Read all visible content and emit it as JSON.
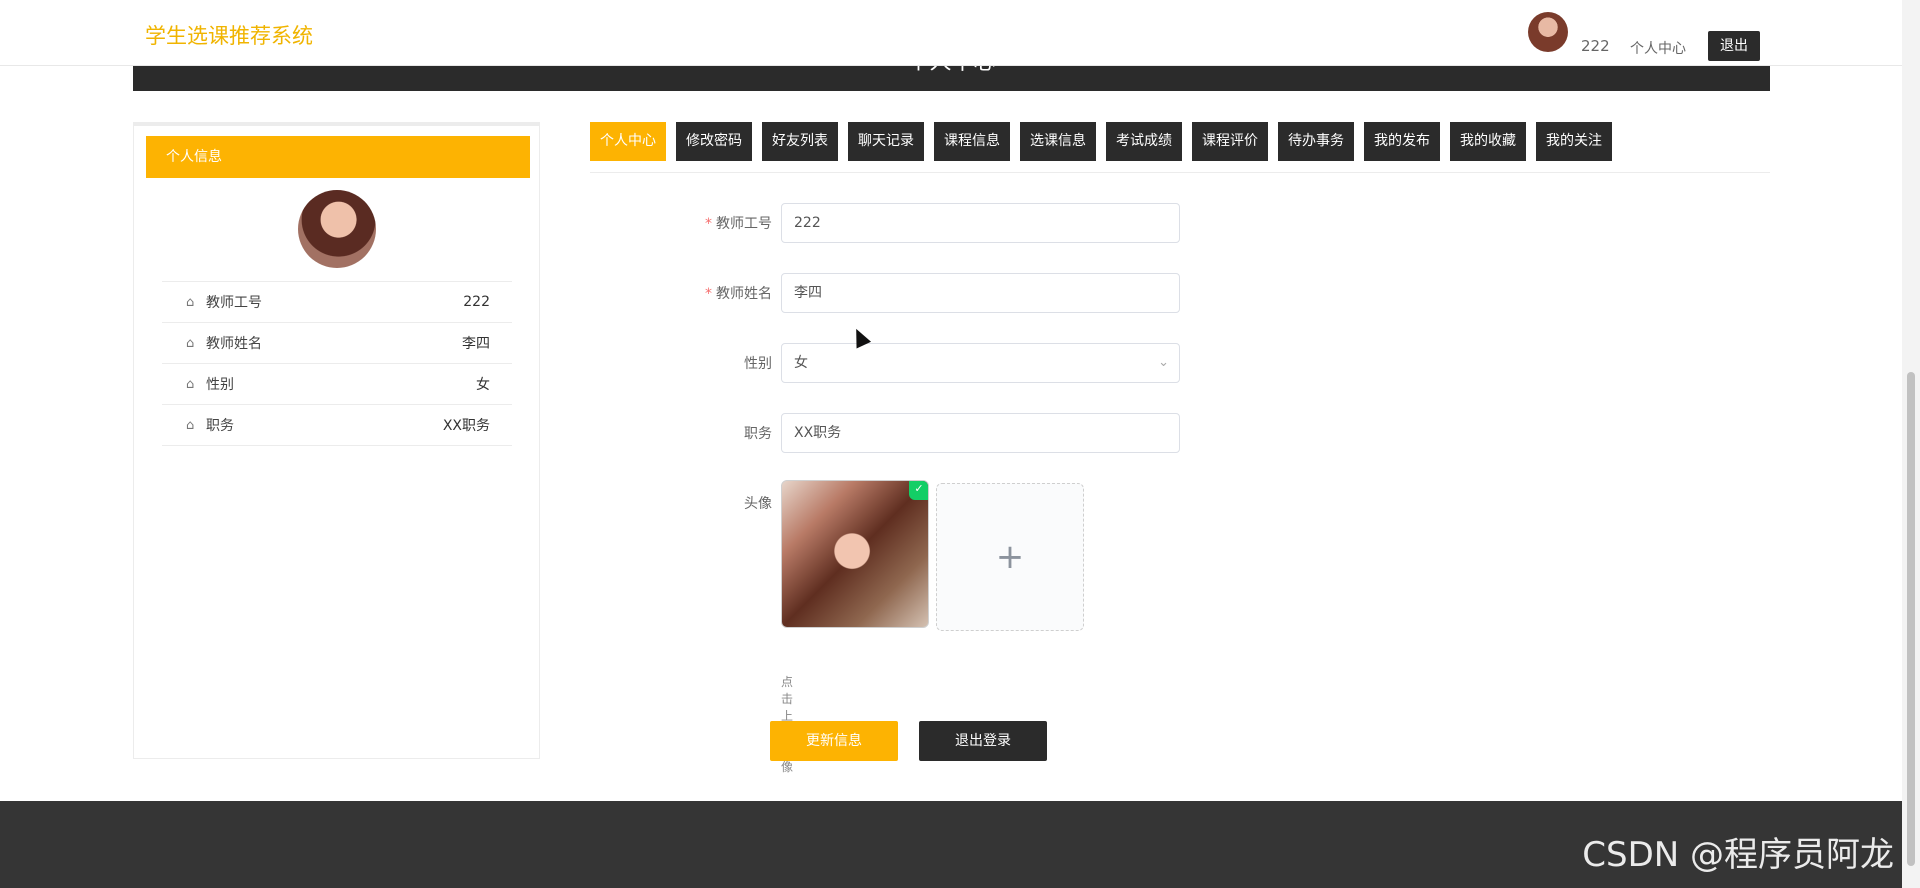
{
  "header": {
    "app_title": "学生选课推荐系统",
    "user_name": "222",
    "profile_center": "个人中心",
    "logout": "退出"
  },
  "banner": {
    "title": "个人中心"
  },
  "left_panel": {
    "title": "个人信息",
    "items": [
      {
        "label": "教师工号",
        "value": "222",
        "icon": "home-icon"
      },
      {
        "label": "教师姓名",
        "value": "李四",
        "icon": "home-icon"
      },
      {
        "label": "性别",
        "value": "女",
        "icon": "home-icon"
      },
      {
        "label": "职务",
        "value": "XX职务",
        "icon": "home-icon"
      }
    ]
  },
  "tabs": [
    {
      "label": "个人中心",
      "active": true
    },
    {
      "label": "修改密码"
    },
    {
      "label": "好友列表"
    },
    {
      "label": "聊天记录"
    },
    {
      "label": "课程信息"
    },
    {
      "label": "选课信息"
    },
    {
      "label": "考试成绩"
    },
    {
      "label": "课程评价"
    },
    {
      "label": "待办事务"
    },
    {
      "label": "我的发布"
    },
    {
      "label": "我的收藏"
    },
    {
      "label": "我的关注"
    }
  ],
  "form": {
    "teacher_id_label": "教师工号",
    "teacher_id_value": "222",
    "teacher_name_label": "教师姓名",
    "teacher_name_value": "李四",
    "gender_label": "性别",
    "gender_value": "女",
    "position_label": "职务",
    "position_value": "XX职务",
    "avatar_label": "头像",
    "upload_tip": "点击上传头像",
    "update_button": "更新信息",
    "logout_button": "退出登录"
  },
  "watermark": "CSDN @程序员阿龙",
  "colors": {
    "accent": "#fdb302",
    "dark": "#2b2b2b",
    "success": "#13ce66"
  }
}
